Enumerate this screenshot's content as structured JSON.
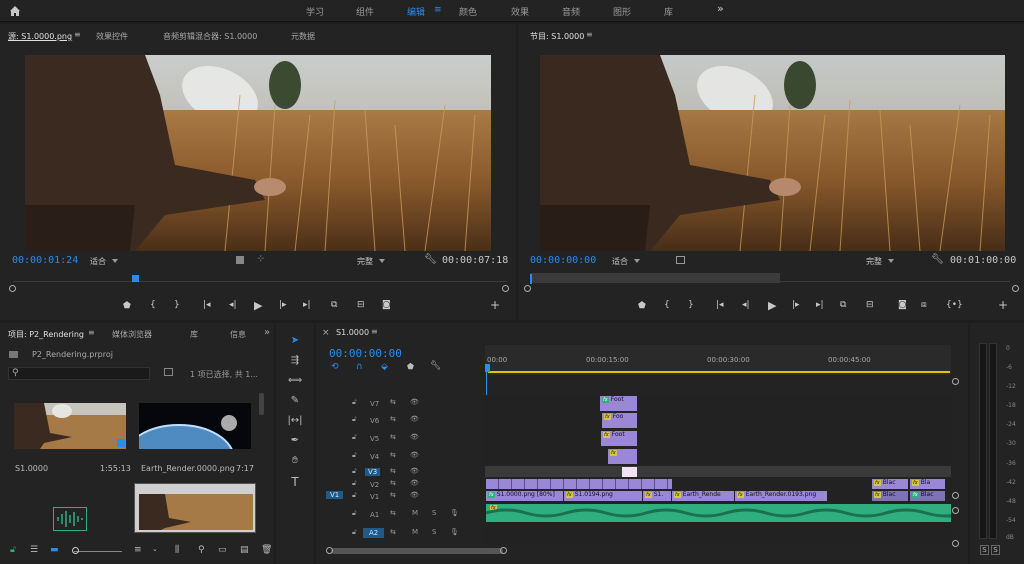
{
  "topbar": {
    "home_icon": "home-icon",
    "workspaces": [
      {
        "label": "学习",
        "active": false
      },
      {
        "label": "组件",
        "active": false
      },
      {
        "label": "编辑",
        "active": true
      },
      {
        "label": "颜色",
        "active": false
      },
      {
        "label": "效果",
        "active": false
      },
      {
        "label": "音频",
        "active": false
      },
      {
        "label": "图形",
        "active": false
      },
      {
        "label": "库",
        "active": false
      }
    ],
    "overflow_label": "»"
  },
  "source_monitor": {
    "tabs": [
      "源: S1.0000.png",
      "效果控件",
      "音频剪辑混合器: S1.0000",
      "元数据"
    ],
    "timecode_in": "00:00:01:24",
    "fit_label": "适合",
    "quality_label": "完整",
    "timecode_out": "00:00:07:18"
  },
  "program_monitor": {
    "title": "节目: S1.0000",
    "timecode_in": "00:00:00:00",
    "fit_label": "适合",
    "quality_label": "完整",
    "timecode_out": "00:01:00:00"
  },
  "project_panel": {
    "tabs": [
      "项目: P2_Rendering",
      "媒体浏览器",
      "库",
      "信息"
    ],
    "project_file": "P2_Rendering.prproj",
    "selection_info": "1 项已选择, 共 1...",
    "search_placeholder": "",
    "items": [
      {
        "name": "S1.0000",
        "duration": "1:55:13"
      },
      {
        "name": "Earth_Render.0000.png",
        "duration": "7:17"
      }
    ]
  },
  "timeline": {
    "title": "S1.0000",
    "timecode": "00:00:00:00",
    "ruler": [
      "00:00",
      "00:00:15:00",
      "00:00:30:00",
      "00:00:45:00"
    ],
    "tracks": [
      {
        "name": "V7"
      },
      {
        "name": "V6"
      },
      {
        "name": "V5"
      },
      {
        "name": "V4"
      },
      {
        "name": "V3"
      },
      {
        "name": "V2"
      },
      {
        "name": "V1"
      },
      {
        "name": "A1"
      },
      {
        "name": "A2"
      }
    ],
    "source_patch_v": "V1",
    "mute_label": "M",
    "solo_label": "S",
    "clips": {
      "v7": "Foot",
      "v6": "Foo",
      "v5": "Foot",
      "v4": "",
      "v1_a": "S1.0000.png [80%]",
      "v1_b": "S1.0194.png",
      "v1_c": "S1.",
      "v1_d": "Earth_Rende",
      "v1_e": "Earth_Render.0193.png",
      "v1_f": "Blac",
      "v1_g": "Blac",
      "v2_f": "Blac",
      "v2_g": "Bla"
    }
  },
  "audio_meter": {
    "labels": [
      "0",
      "-6",
      "-12",
      "-18",
      "-24",
      "-30",
      "-36",
      "-42",
      "-48",
      "-54",
      "dB"
    ],
    "solo_labels": [
      "S",
      "S"
    ]
  },
  "colors": {
    "accent": "#2d8ceb",
    "clip_video": "#9a87d6",
    "clip_audio": "#2fae7f"
  }
}
